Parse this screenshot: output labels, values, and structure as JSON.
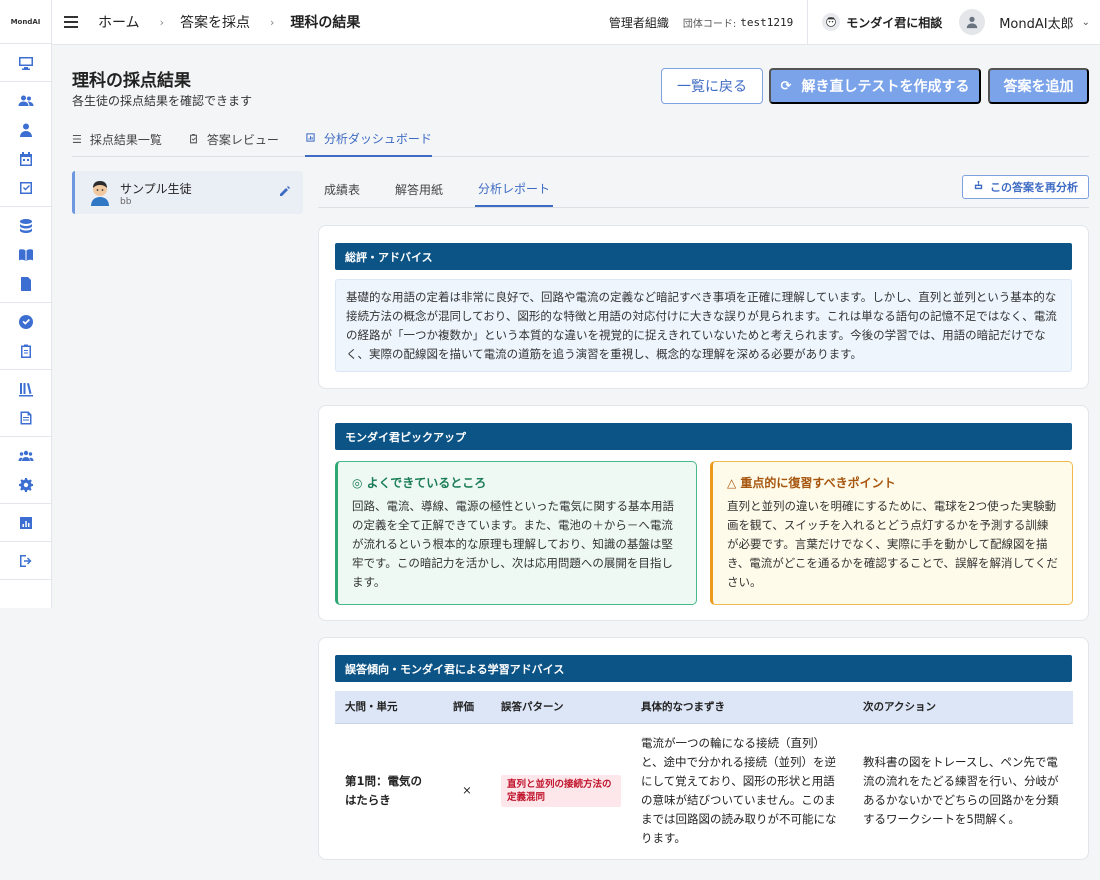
{
  "rail": {
    "logo": "MondAI",
    "icons": [
      "monitor-icon",
      "users-icon",
      "teacher-icon",
      "calendar-icon",
      "checkbox-icon",
      "database-icon",
      "book-icon",
      "document-icon",
      "verified-icon",
      "clipboard-icon",
      "library-icon",
      "article-icon",
      "group-icon",
      "gear-icon",
      "chart-icon",
      "logout-icon"
    ]
  },
  "topbar": {
    "breadcrumbs": [
      "ホーム",
      "答案を採点",
      "理科の結果"
    ],
    "org": "管理者組織",
    "code_label": "団体コード:",
    "code_value": "test1219",
    "consult": "モンダイ君に相談",
    "user_name": "MondAI太郎"
  },
  "header": {
    "title": "理科の採点結果",
    "subtitle": "各生徒の採点結果を確認できます",
    "back_label": "一覧に戻る",
    "retest_label": "解き直しテストを作成する",
    "add_label": "答案を追加"
  },
  "main_tabs": [
    {
      "label": "採点結果一覧",
      "icon": "list-icon"
    },
    {
      "label": "答案レビュー",
      "icon": "clipboard-check-icon"
    },
    {
      "label": "分析ダッシュボード",
      "icon": "dashboard-icon",
      "active": true
    }
  ],
  "student": {
    "name": "サンプル生徒",
    "id": "bb"
  },
  "sub_tabs": [
    {
      "label": "成績表"
    },
    {
      "label": "解答用紙"
    },
    {
      "label": "分析レポート",
      "active": true
    }
  ],
  "reanalyze_label": "この答案を再分析",
  "advice": {
    "heading": "総評・アドバイス",
    "body": "基礎的な用語の定着は非常に良好で、回路や電流の定義など暗記すべき事項を正確に理解しています。しかし、直列と並列という基本的な接続方法の概念が混同しており、図形的な特徴と用語の対応付けに大きな誤りが見られます。これは単なる語句の記憶不足ではなく、電流の経路が「一つか複数か」という本質的な違いを視覚的に捉えきれていないためと考えられます。今後の学習では、用語の暗記だけでなく、実際の配線図を描いて電流の道筋を追う演習を重視し、概念的な理解を深める必要があります。"
  },
  "pickup": {
    "heading": "モンダイ君ピックアップ",
    "good_title": "◎ よくできているところ",
    "good_body": "回路、電流、導線、電源の極性といった電気に関する基本用語の定義を全て正解できています。また、電池の＋から－へ電流が流れるという根本的な原理も理解しており、知識の基盤は堅牢です。この暗記力を活かし、次は応用問題への展開を目指します。",
    "bad_title": "△ 重点的に復習すべきポイント",
    "bad_body": "直列と並列の違いを明確にするために、電球を2つ使った実験動画を観て、スイッチを入れるとどう点灯するかを予測する訓練が必要です。言葉だけでなく、実際に手を動かして配線図を描き、電流がどこを通るかを確認することで、誤解を解消してください。"
  },
  "errors": {
    "heading": "誤答傾向・モンダイ君による学習アドバイス",
    "columns": [
      "大問・単元",
      "評価",
      "誤答パターン",
      "具体的なつまずき",
      "次のアクション"
    ],
    "rows": [
      {
        "unit": "第1問：電気のはたらき",
        "mark": "×",
        "pattern": "直列と並列の接続方法の定義混同",
        "issue": "電流が一つの輪になる接続（直列）と、途中で分かれる接続（並列）を逆にして覚えており、図形の形状と用語の意味が結びついていません。このままでは回路図の読み取りが不可能になります。",
        "action": "教科書の図をトレースし、ペン先で電流の流れをたどる練習を行い、分岐があるかないかでどちらの回路かを分類するワークシートを5問解く。"
      }
    ]
  }
}
